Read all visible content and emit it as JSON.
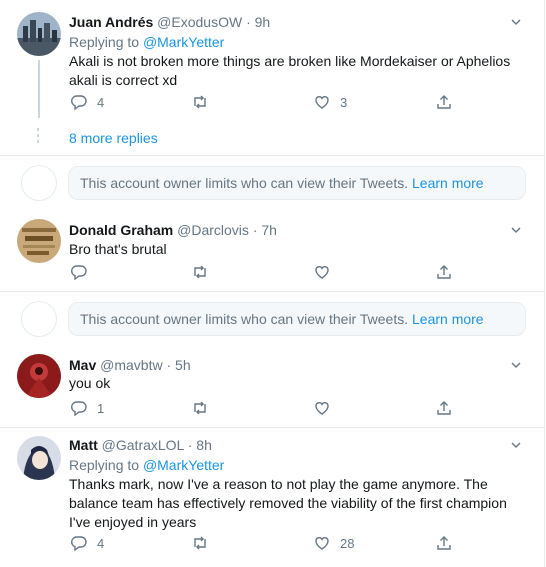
{
  "tweets": [
    {
      "name": "Juan Andrés",
      "handle": "@ExodusOW",
      "time": "9h",
      "replying_prefix": "Replying to",
      "replying_to": "@MarkYetter",
      "text": "Akali is not broken more things are broken like Mordekaiser or Aphelios akali is correct xd",
      "replies": "4",
      "retweets": "",
      "likes": "3"
    },
    {
      "name": "Donald Graham",
      "handle": "@Darclovis",
      "time": "7h",
      "text": "Bro that's brutal",
      "replies": "",
      "retweets": "",
      "likes": ""
    },
    {
      "name": "Mav",
      "handle": "@mavbtw",
      "time": "5h",
      "text": "you ok",
      "replies": "1",
      "retweets": "",
      "likes": ""
    },
    {
      "name": "Matt",
      "handle": "@GatraxLOL",
      "time": "8h",
      "replying_prefix": "Replying to",
      "replying_to": "@MarkYetter",
      "text": "Thanks mark, now I've a reason to not play the game anymore. The balance team has effectively removed the viability of the first champion I've enjoyed in years",
      "replies": "4",
      "retweets": "",
      "likes": "28"
    }
  ],
  "more_replies": "8 more replies",
  "limited_notice": {
    "text": "This account owner limits who can view their Tweets.",
    "link": "Learn more"
  },
  "separator": "·",
  "colors": {
    "accent": "#1b95e0",
    "muted": "#657786",
    "border": "#e6ecf0"
  },
  "icons": [
    "reply-icon",
    "retweet-icon",
    "like-icon",
    "share-icon",
    "chevron-down-icon"
  ]
}
